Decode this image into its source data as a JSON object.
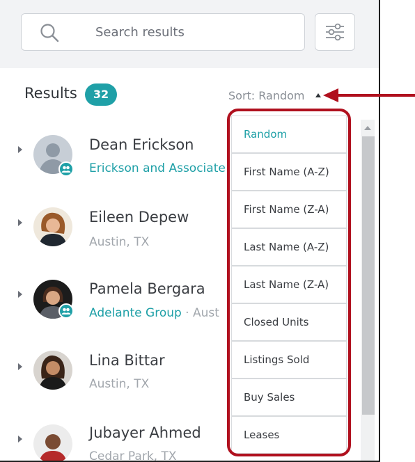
{
  "search": {
    "placeholder": "Search results"
  },
  "results": {
    "label": "Results",
    "count": "32"
  },
  "sort": {
    "label": "Sort: Random"
  },
  "sort_menu": {
    "items": [
      {
        "label": "Random",
        "selected": true
      },
      {
        "label": "First Name (A-Z)"
      },
      {
        "label": "First Name (Z-A)"
      },
      {
        "label": "Last Name (A-Z)"
      },
      {
        "label": "Last Name (Z-A)"
      },
      {
        "label": "Closed Units"
      },
      {
        "label": "Listings Sold"
      },
      {
        "label": "Buy Sales"
      },
      {
        "label": "Leases"
      }
    ]
  },
  "agents": [
    {
      "name": "Dean Erickson",
      "company": "Erickson and Associate",
      "location": "",
      "team_badge": true
    },
    {
      "name": "Eileen Depew",
      "company": "",
      "location": "Austin, TX",
      "team_badge": false
    },
    {
      "name": "Pamela Bergara",
      "company": "Adelante Group",
      "location": " · Aust",
      "team_badge": true
    },
    {
      "name": "Lina Bittar",
      "company": "",
      "location": "Austin, TX",
      "team_badge": false
    },
    {
      "name": "Jubayer Ahmed",
      "company": "",
      "location": "Cedar Park, TX",
      "team_badge": false
    }
  ],
  "icons": {
    "search": "search-icon",
    "filter": "sliders-icon",
    "sort_caret": "caret-up-icon",
    "row_toggle": "caret-right-icon",
    "team": "team-icon"
  },
  "colors": {
    "accent": "#1fa0a7",
    "highlight": "#b0101e",
    "header_bg": "#f2f3f5"
  }
}
